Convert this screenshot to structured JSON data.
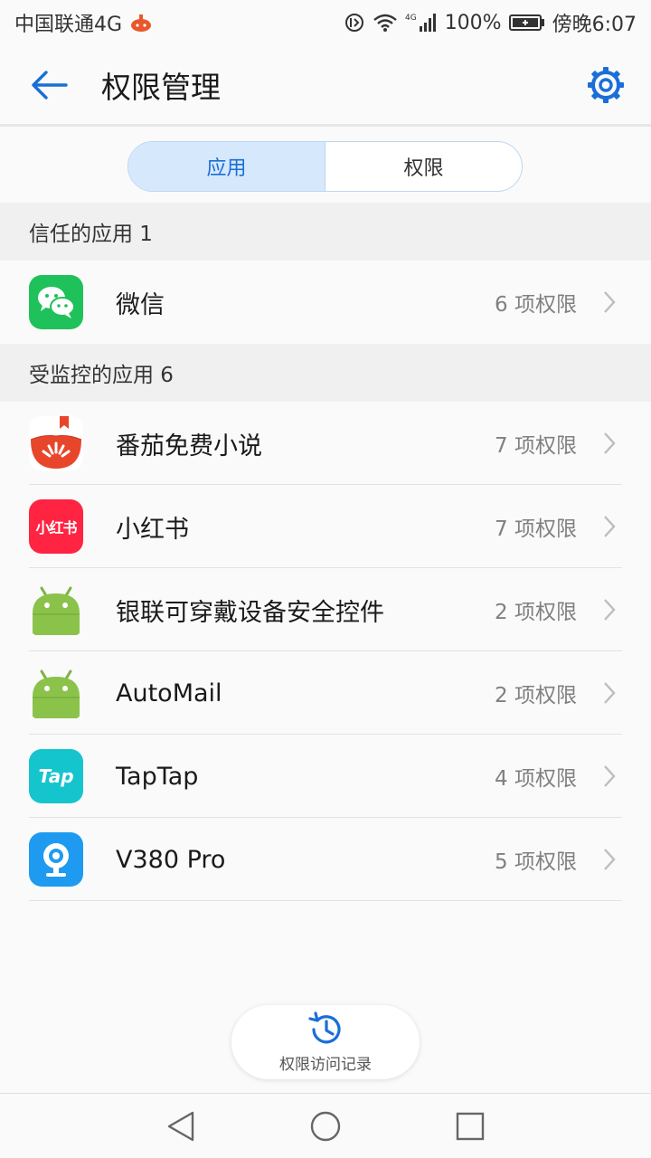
{
  "status_bar": {
    "carrier": "中国联通4G",
    "battery": "100%",
    "time": "傍晚6:07",
    "network_badge": "4G",
    "icons": [
      "notification-icon",
      "data-saver-icon",
      "wifi-icon",
      "signal-icon",
      "battery-icon"
    ]
  },
  "header": {
    "title": "权限管理",
    "back_icon": "back-arrow-icon",
    "settings_icon": "gear-icon"
  },
  "tabs": [
    {
      "label": "应用",
      "active": true
    },
    {
      "label": "权限",
      "active": false
    }
  ],
  "sections": {
    "trusted": {
      "header": "信任的应用 1",
      "apps": [
        {
          "name": "微信",
          "permissions": "6 项权限",
          "icon": "wechat-icon"
        }
      ]
    },
    "monitored": {
      "header": "受监控的应用 6",
      "apps": [
        {
          "name": "番茄免费小说",
          "permissions": "7 项权限",
          "icon": "tomato-novel-icon"
        },
        {
          "name": "小红书",
          "permissions": "7 项权限",
          "icon": "xiaohongshu-icon",
          "icon_text": "小红书"
        },
        {
          "name": "银联可穿戴设备安全控件",
          "permissions": "2 项权限",
          "icon": "android-icon"
        },
        {
          "name": "AutoMail",
          "permissions": "2 项权限",
          "icon": "android-icon"
        },
        {
          "name": "TapTap",
          "permissions": "4 项权限",
          "icon": "taptap-icon",
          "icon_text": "Tap"
        },
        {
          "name": "V380 Pro",
          "permissions": "5 项权限",
          "icon": "v380-camera-icon"
        }
      ]
    }
  },
  "history_button": {
    "label": "权限访问记录",
    "icon": "history-clock-icon"
  },
  "nav_bar": {
    "icons": [
      "nav-back-icon",
      "nav-home-icon",
      "nav-recents-icon"
    ]
  },
  "colors": {
    "accent": "#1a6ed8",
    "tab_active_bg": "#d6e8fb",
    "wechat": "#1fc15a",
    "tomato": "#e8462a",
    "xiaohongshu": "#ff2442",
    "android": "#8bc34a",
    "taptap": "#15c5ce",
    "v380": "#1e9bf0"
  }
}
